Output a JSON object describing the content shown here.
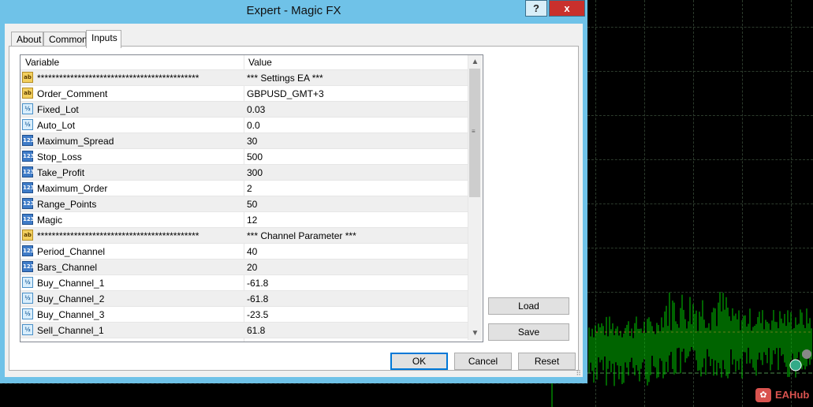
{
  "window": {
    "title": "Expert - Magic FX",
    "help_label": "?",
    "close_label": "x"
  },
  "tabs": [
    {
      "label": "About",
      "active": false
    },
    {
      "label": "Common",
      "active": false
    },
    {
      "label": "Inputs",
      "active": true
    }
  ],
  "table": {
    "headers": {
      "variable": "Variable",
      "value": "Value"
    },
    "rows": [
      {
        "icon": "ab",
        "variable": "********************************************",
        "value": "*** Settings EA ***"
      },
      {
        "icon": "ab",
        "variable": "Order_Comment",
        "value": "GBPUSD_GMT+3"
      },
      {
        "icon": "half",
        "variable": "Fixed_Lot",
        "value": "0.03"
      },
      {
        "icon": "half",
        "variable": "Auto_Lot",
        "value": "0.0"
      },
      {
        "icon": "num",
        "variable": "Maximum_Spread",
        "value": "30"
      },
      {
        "icon": "num",
        "variable": "Stop_Loss",
        "value": "500"
      },
      {
        "icon": "num",
        "variable": "Take_Profit",
        "value": "300"
      },
      {
        "icon": "num",
        "variable": "Maximum_Order",
        "value": "2"
      },
      {
        "icon": "num",
        "variable": "Range_Points",
        "value": "50"
      },
      {
        "icon": "num",
        "variable": "Magic",
        "value": "12"
      },
      {
        "icon": "ab",
        "variable": "********************************************",
        "value": "*** Channel Parameter ***"
      },
      {
        "icon": "num",
        "variable": "Period_Channel",
        "value": "40"
      },
      {
        "icon": "num",
        "variable": "Bars_Channel",
        "value": "20"
      },
      {
        "icon": "half",
        "variable": "Buy_Channel_1",
        "value": "-61.8"
      },
      {
        "icon": "half",
        "variable": "Buy_Channel_2",
        "value": "-61.8"
      },
      {
        "icon": "half",
        "variable": "Buy_Channel_3",
        "value": "-23.5"
      },
      {
        "icon": "half",
        "variable": "Sell_Channel_1",
        "value": "61.8"
      }
    ]
  },
  "icon_text": {
    "ab": "ab",
    "half": "½",
    "num": "123"
  },
  "buttons": {
    "load": "Load",
    "save": "Save",
    "ok": "OK",
    "cancel": "Cancel",
    "reset": "Reset"
  },
  "watermark": {
    "text": "EAHub"
  },
  "colors": {
    "title_bar": "#6fc2e8",
    "close_button": "#c9302c",
    "chart_bars": "#00c800",
    "chart_background": "#000000"
  }
}
